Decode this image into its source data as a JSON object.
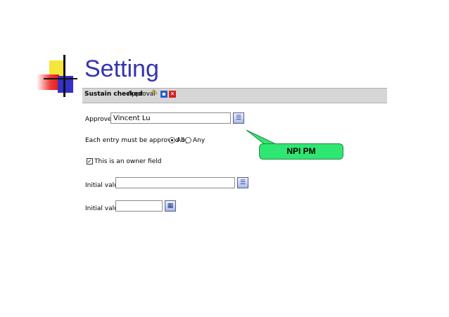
{
  "slide": {
    "title": "Setting"
  },
  "toolbar": {
    "sustain_label": "Sustain checked",
    "approval_label": "Approval",
    "icons": [
      "pencil-icon",
      "save-icon",
      "delete-icon"
    ]
  },
  "approvers": {
    "label": "Approvers",
    "value": "Vincent Lu"
  },
  "approval_mode": {
    "label": "Each entry must be approved by:",
    "options": [
      {
        "label": "All",
        "selected": true
      },
      {
        "label": "Any",
        "selected": false
      }
    ]
  },
  "owner_field": {
    "label": "This is an owner field",
    "checked": true
  },
  "initial_value_1": {
    "label": "Initial value",
    "value": ""
  },
  "initial_value_2": {
    "label": "Initial value",
    "value": ""
  },
  "callout": {
    "text": "NPI PM"
  },
  "colors": {
    "title": "#3333b0",
    "callout": "#2ee672",
    "toolbar": "#d6d6d6"
  }
}
